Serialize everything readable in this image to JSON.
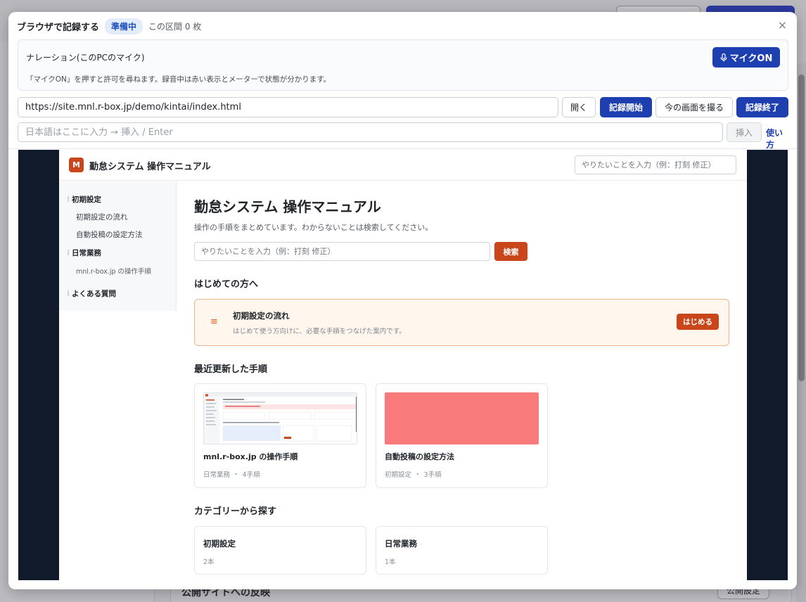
{
  "recorder": {
    "title": "ブラウザで記録する",
    "status": "準備中",
    "count_text": "この区間 0 枚",
    "close_symbol": "×",
    "narration": {
      "title": "ナレーション(このPCのマイク)",
      "hint": "「マイクON」を押すと許可を尋ねます。録音中は赤い表示とメーターで状態が分かります。",
      "mic_label": "マイクON"
    },
    "url": "https://site.mnl.r-box.jp/demo/kintai/index.html",
    "open_label": "開く",
    "start_label": "記録開始",
    "shot_label": "今の画面を撮る",
    "end_label": "記録終了",
    "jp_placeholder": "日本語はここに入力 → 挿入 / Enter",
    "insert_label": "挿入",
    "help_label": "使い方"
  },
  "preview": {
    "logo_letter": "M",
    "brand": "勤怠システム 操作マニュアル",
    "header_search_placeholder": "やりたいことを入力（例：打刻 修正）",
    "sidebar": {
      "groups": [
        {
          "label": "初期設定",
          "items": [
            "初期設定の流れ",
            "自動投稿の設定方法"
          ]
        },
        {
          "label": "日常業務",
          "items": [
            "mnl.r-box.jp の操作手順"
          ]
        },
        {
          "label": "よくある質問",
          "items": []
        }
      ]
    },
    "main": {
      "title": "勤怠システム 操作マニュアル",
      "lead": "操作の手順をまとめています。わからないことは検索してください。",
      "search_placeholder": "やりたいことを入力（例：打刻 修正）",
      "search_button": "検索",
      "intro_heading": "はじめての方へ",
      "start_card": {
        "icon": "≡",
        "title": "初期設定の流れ",
        "desc": "はじめて使う方向けに、必要な手順をつなげた案内です。",
        "button": "はじめる"
      },
      "recent_heading": "最近更新した手順",
      "recent": [
        {
          "title": "mnl.r-box.jp の操作手順",
          "category": "日常業務",
          "dot": "・",
          "steps": "4手順",
          "thumb": "screenshot"
        },
        {
          "title": "自動投稿の設定方法",
          "category": "初期設定",
          "dot": "・",
          "steps": "3手順",
          "thumb": "color",
          "thumb_color": "#f97a7a"
        }
      ],
      "category_heading": "カテゴリーから探す",
      "categories": [
        {
          "title": "初期設定",
          "count": "2本"
        },
        {
          "title": "日常業務",
          "count": "1本"
        }
      ]
    }
  },
  "background": {
    "bottom_title": "公開サイトへの反映",
    "bottom_button": "公開設定"
  },
  "colors": {
    "primary": "#1e3fb0",
    "accent": "#c8461a",
    "preview_frame": "#111a2b",
    "thumb_red": "#f97a7a"
  }
}
